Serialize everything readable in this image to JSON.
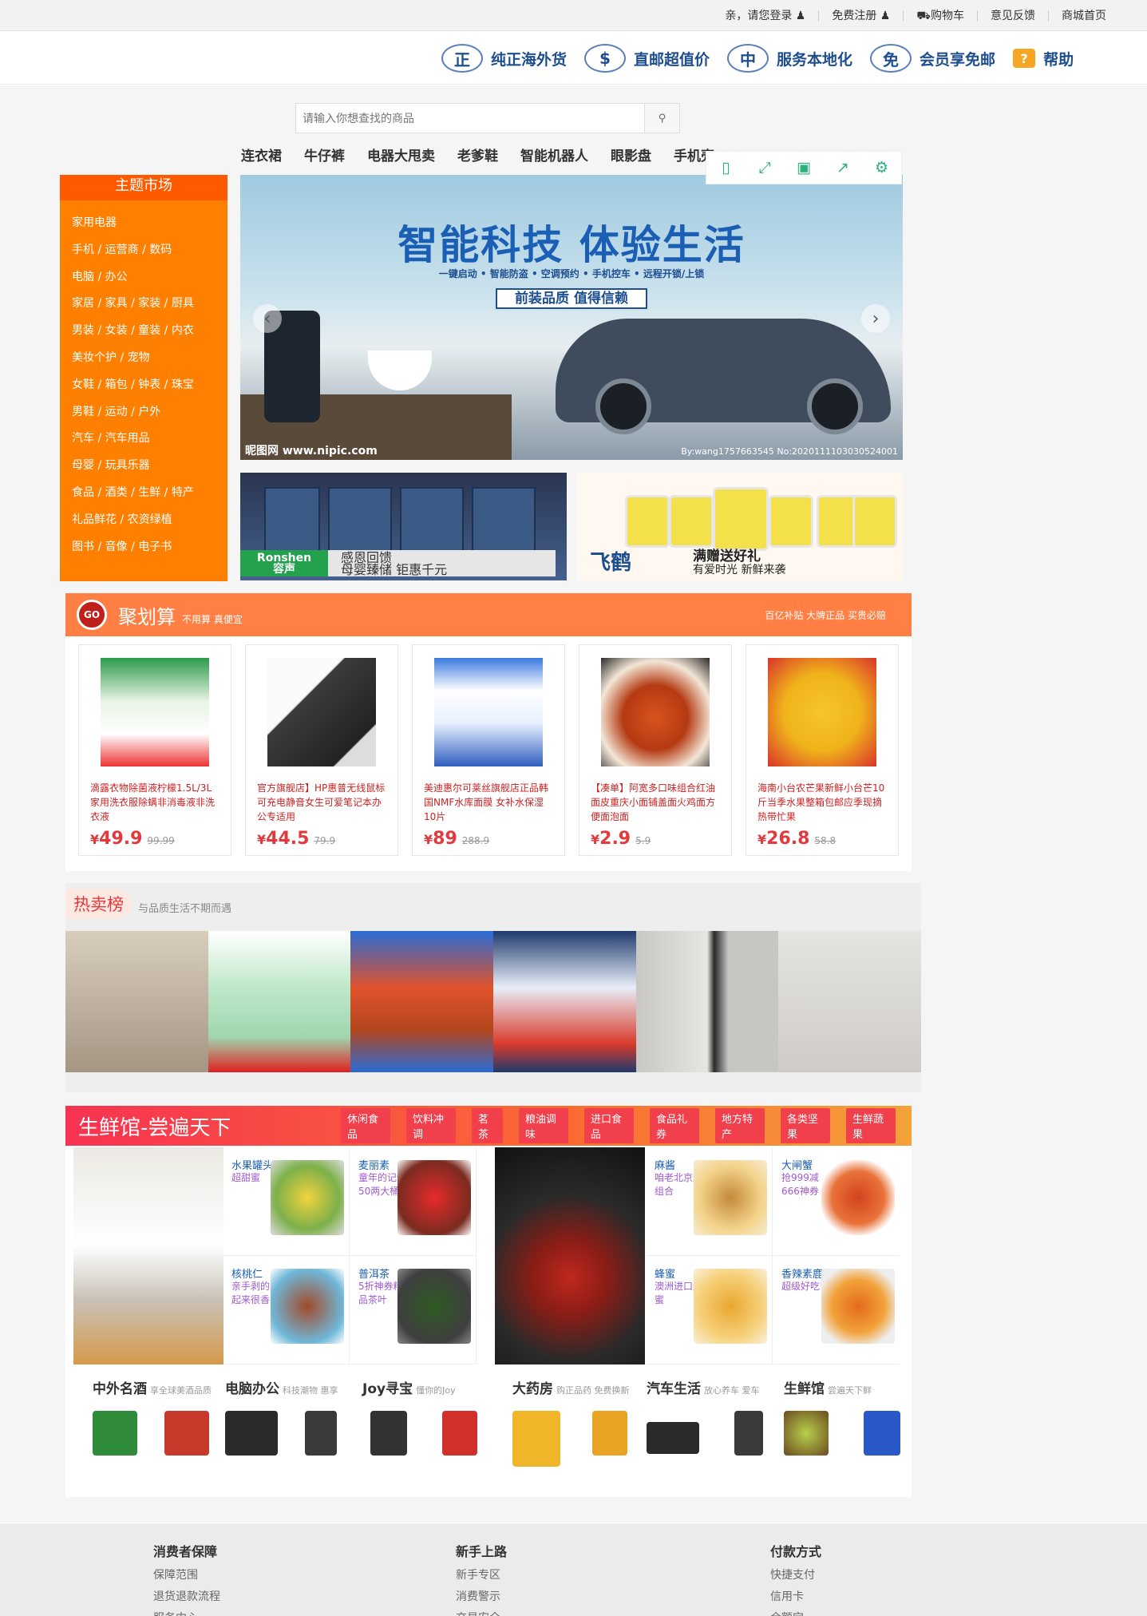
{
  "topbar": {
    "login": "亲，请您登录",
    "register": "免费注册",
    "cart": "购物车",
    "feedback": "意见反馈",
    "home": "商城首页"
  },
  "promise": [
    {
      "badge": "正",
      "label": "纯正海外货"
    },
    {
      "badge": "$",
      "label": "直邮超值价"
    },
    {
      "badge": "中",
      "label": "服务本地化"
    },
    {
      "badge": "免",
      "label": "会员享免邮"
    },
    {
      "badge": "?",
      "label": "帮助"
    }
  ],
  "search": {
    "placeholder": "请输入你想查找的商品"
  },
  "hotwords": [
    "连衣裙",
    "牛仔裤",
    "电器大甩卖",
    "老爹鞋",
    "智能机器人",
    "眼影盘",
    "手机壳"
  ],
  "category": {
    "title": "主题市场",
    "items": [
      "家用电器",
      "手机 / 运营商 / 数码",
      "电脑 / 办公",
      "家居 / 家具 / 家装 / 厨具",
      "男装 / 女装 / 童装 / 内衣",
      "美妆个护 / 宠物",
      "女鞋 / 箱包 / 钟表 / 珠宝",
      "男鞋 / 运动 / 户外",
      "汽车 / 汽车用品",
      "母婴 / 玩具乐器",
      "食品 / 酒类 / 生鲜 / 特产",
      "礼品鲜花 / 农资绿植",
      "图书 / 音像 / 电子书"
    ]
  },
  "banner": {
    "title": "智能科技  体验生活",
    "subtitle": "一键启动 • 智能防盗 • 空调预约 • 手机控车 • 远程开锁/上锁",
    "tag": "前装品质 值得信赖",
    "watermark_left": "昵图网 www.nipic.com",
    "watermark_right": "By:wang1757663545 No:20201111030305240​01"
  },
  "small_banners": [
    {
      "brand": "Ronshen",
      "brand_cn": "容声",
      "line1": "感恩回馈",
      "line2": "母婴臻储 钜惠千元"
    },
    {
      "brand": "飞鹤",
      "line1": "满赠送好礼",
      "line2": "有爱时光 新鲜来袭"
    }
  ],
  "juhuasuan": {
    "badge": "GO",
    "title": "聚划算",
    "subtitle": "不用算 真便宜",
    "right": "百亿补贴 大牌正品 买贵必赔",
    "products": [
      {
        "name": "滴露衣物除菌液柠檬1.5L/3L家用洗衣服除螨非消毒液非洗衣液",
        "price": "49.9",
        "old": "99.99"
      },
      {
        "name": "官方旗舰店】HP惠普无线鼠标可充电静音女生可爱笔记本办公专适用",
        "price": "44.5",
        "old": "79.9"
      },
      {
        "name": "美迪惠尔可莱丝旗舰店正品韩国NMF水库面膜 女补水保湿10片",
        "price": "89",
        "old": "288.9"
      },
      {
        "name": "【凑单】阿宽多口味组合红油面皮重庆小面铺盖面火鸡面方便面泡面",
        "price": "2.9",
        "old": "5.9"
      },
      {
        "name": "海南小台农芒果新鲜小台芒10斤当季水果整箱包邮应季现摘热带忙果",
        "price": "26.8",
        "old": "58.8"
      }
    ]
  },
  "hot": {
    "title": "热卖榜",
    "subtitle": "与品质生活不期而遇"
  },
  "fresh": {
    "title": "生鲜馆-尝遍天下",
    "tabs": [
      "休闲食品",
      "饮料冲调",
      "茗茶",
      "粮油调味",
      "进口食品",
      "食品礼券",
      "地方特产",
      "各类坚果",
      "生鲜蔬果"
    ],
    "cells": [
      {
        "title": "水果罐头",
        "desc": "超甜蜜"
      },
      {
        "title": "麦丽素",
        "desc": "童年的记忆 50两大桶!"
      },
      {
        "title": "核桃仁",
        "desc": "亲手剥的吃起来很香"
      },
      {
        "title": "普洱茶",
        "desc": "5折神券精品茶叶"
      },
      {
        "title": "麻酱",
        "desc": "咱老北京儿组合"
      },
      {
        "title": "大闸蟹",
        "desc": "抢999减666神券"
      },
      {
        "title": "蜂蜜",
        "desc": "澳洲进口蜂蜜"
      },
      {
        "title": "香辣素鹿茸",
        "desc": "超级好吃!"
      }
    ],
    "brands": [
      {
        "title": "中外名酒",
        "desc": "享全球美酒品质"
      },
      {
        "title": "电脑办公",
        "desc": "科技潮物 惠享"
      },
      {
        "title": "Joy寻宝",
        "desc": "懂你的Joy"
      },
      {
        "title": "大药房",
        "desc": "购正品药 免费换新"
      },
      {
        "title": "汽车生活",
        "desc": "放心养车 爱车"
      },
      {
        "title": "生鲜馆",
        "desc": "尝遍天下鲜"
      }
    ]
  },
  "footer": [
    {
      "title": "消费者保障",
      "links": [
        "保障范围",
        "退货退款流程",
        "服务中心"
      ]
    },
    {
      "title": "新手上路",
      "links": [
        "新手专区",
        "消费警示",
        "交易安全"
      ]
    },
    {
      "title": "付款方式",
      "links": [
        "快捷支付",
        "信用卡",
        "余额宝"
      ]
    }
  ]
}
